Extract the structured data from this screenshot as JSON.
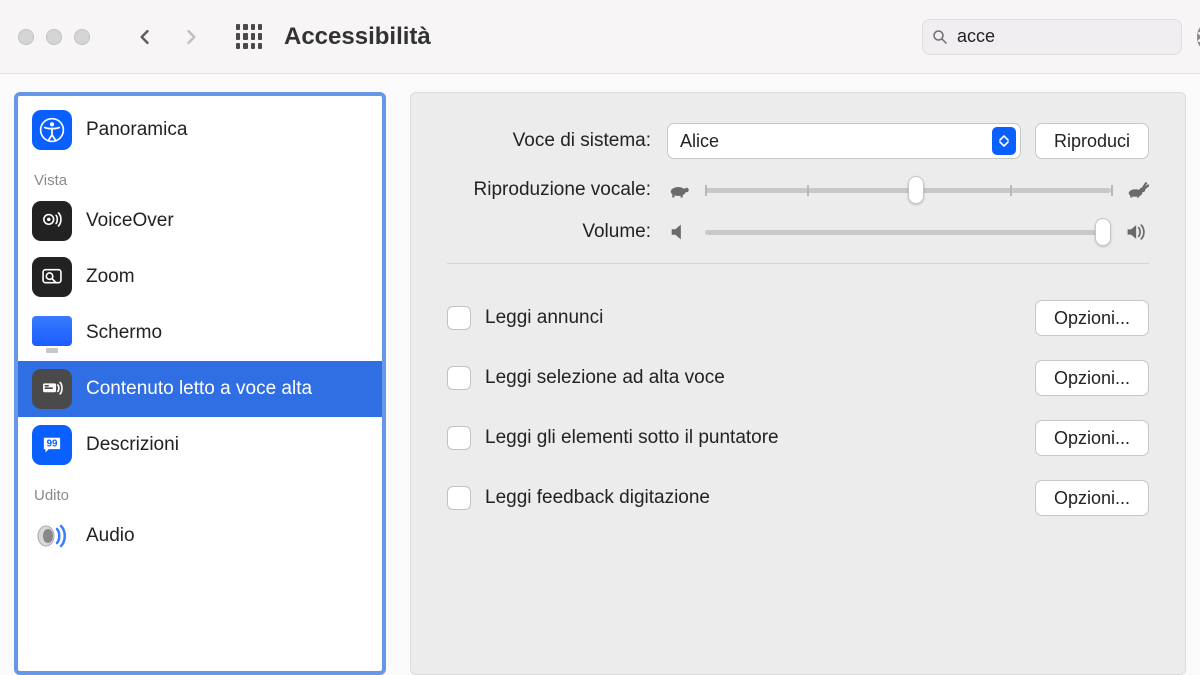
{
  "window": {
    "title": "Accessibilità"
  },
  "search": {
    "value": "acce"
  },
  "sidebar": {
    "overview": {
      "label": "Panoramica"
    },
    "section_vista": "Vista",
    "voiceover": {
      "label": "VoiceOver"
    },
    "zoom": {
      "label": "Zoom"
    },
    "display": {
      "label": "Schermo"
    },
    "spoken": {
      "label": "Contenuto letto a voce alta"
    },
    "descriptions": {
      "label": "Descrizioni"
    },
    "section_udito": "Udito",
    "audio": {
      "label": "Audio"
    }
  },
  "panel": {
    "system_voice_label": "Voce di sistema:",
    "system_voice_value": "Alice",
    "play_button": "Riproduci",
    "rate_label": "Riproduzione vocale:",
    "volume_label": "Volume:",
    "options_button": "Opzioni...",
    "checks": [
      {
        "label": "Leggi annunci"
      },
      {
        "label": "Leggi selezione ad alta voce"
      },
      {
        "label": "Leggi gli elementi sotto il puntatore"
      },
      {
        "label": "Leggi feedback digitazione"
      }
    ]
  }
}
